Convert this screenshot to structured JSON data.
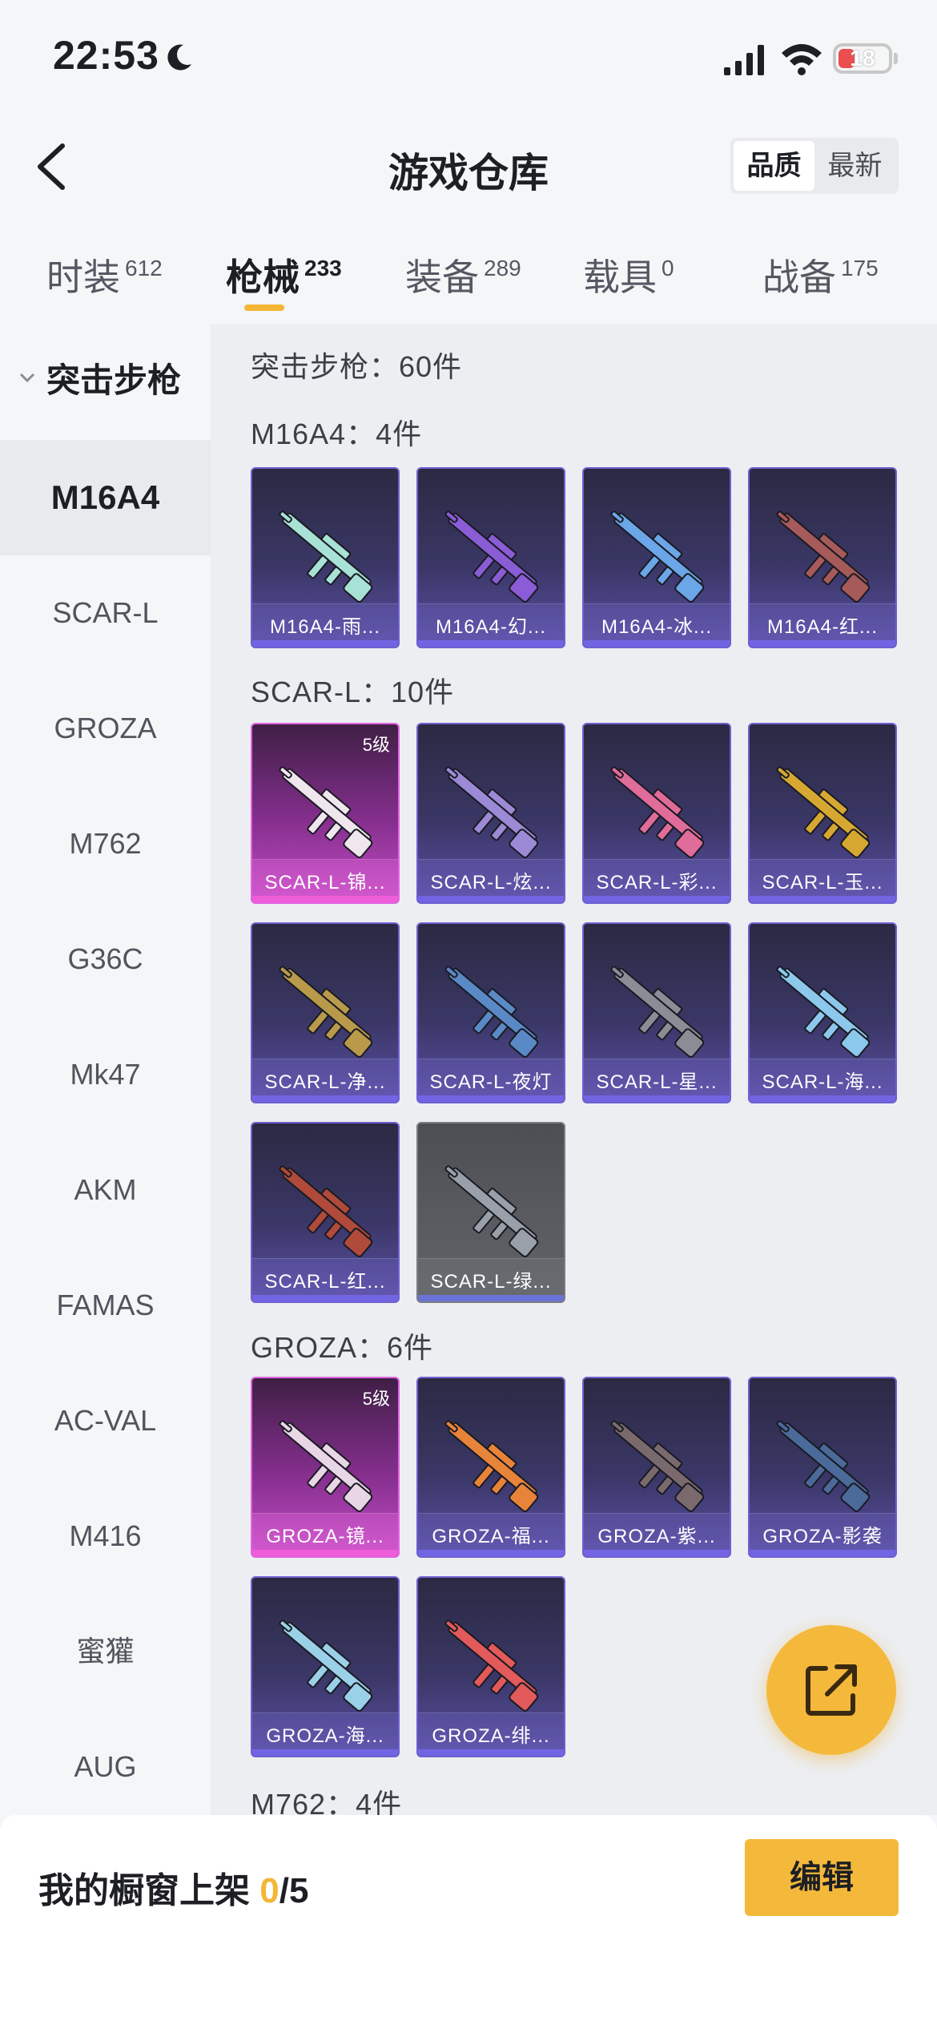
{
  "status_bar": {
    "time": "22:53",
    "battery": "18"
  },
  "header": {
    "title": "游戏仓库",
    "sort_quality": "品质",
    "sort_newest": "最新"
  },
  "tabs": [
    {
      "label": "时装",
      "count": "612"
    },
    {
      "label": "枪械",
      "count": "233"
    },
    {
      "label": "装备",
      "count": "289"
    },
    {
      "label": "载具",
      "count": "0"
    },
    {
      "label": "战备",
      "count": "175"
    }
  ],
  "sidebar": {
    "group": "突击步枪",
    "items": [
      "M16A4",
      "SCAR-L",
      "GROZA",
      "M762",
      "G36C",
      "Mk47",
      "AKM",
      "FAMAS",
      "AC-VAL",
      "M416",
      "蜜獾",
      "AUG"
    ]
  },
  "content": {
    "category_header": "突击步枪：60件",
    "sections": [
      {
        "title": "M16A4：4件",
        "items": [
          {
            "label": "M16A4-雨...",
            "rarity": "purple",
            "color": "#a8e2d6"
          },
          {
            "label": "M16A4-幻...",
            "rarity": "purple",
            "color": "#8a5cd6"
          },
          {
            "label": "M16A4-冰...",
            "rarity": "purple",
            "color": "#6aa6e8"
          },
          {
            "label": "M16A4-红...",
            "rarity": "purple",
            "color": "#a65a5a"
          }
        ]
      },
      {
        "title": "SCAR-L：10件",
        "items": [
          {
            "label": "SCAR-L-锦...",
            "rarity": "pink",
            "level": "5级",
            "color": "#f0e6ee"
          },
          {
            "label": "SCAR-L-炫...",
            "rarity": "purple",
            "color": "#9c8ad6"
          },
          {
            "label": "SCAR-L-彩...",
            "rarity": "purple",
            "color": "#e06c9a"
          },
          {
            "label": "SCAR-L-玉...",
            "rarity": "purple",
            "color": "#d6a832"
          },
          {
            "label": "SCAR-L-净...",
            "rarity": "purple",
            "color": "#b89a4a"
          },
          {
            "label": "SCAR-L-夜灯",
            "rarity": "purple",
            "color": "#5a8ac6"
          },
          {
            "label": "SCAR-L-星...",
            "rarity": "purple",
            "color": "#8a8c96"
          },
          {
            "label": "SCAR-L-海...",
            "rarity": "purple",
            "color": "#8cc8ec"
          },
          {
            "label": "SCAR-L-红...",
            "rarity": "purple",
            "color": "#b04a3a"
          },
          {
            "label": "SCAR-L-绿...",
            "rarity": "gray",
            "color": "#9aa0aa"
          }
        ]
      },
      {
        "title": "GROZA：6件",
        "items": [
          {
            "label": "GROZA-镜...",
            "rarity": "pink",
            "level": "5级",
            "color": "#e8d6e6"
          },
          {
            "label": "GROZA-福...",
            "rarity": "purple",
            "color": "#e8843a"
          },
          {
            "label": "GROZA-紫...",
            "rarity": "purple",
            "color": "#7a6a6e"
          },
          {
            "label": "GROZA-影袭",
            "rarity": "purple",
            "color": "#4a6a9a"
          },
          {
            "label": "GROZA-海...",
            "rarity": "purple",
            "color": "#9ad0e8"
          },
          {
            "label": "GROZA-绯...",
            "rarity": "purple",
            "color": "#e25a5a"
          }
        ]
      },
      {
        "title": "M762：4件",
        "items": []
      }
    ]
  },
  "bottom": {
    "showcase_label": "我的橱窗上架 ",
    "showcase_current": "0",
    "showcase_total": "/5",
    "edit_label": "编辑"
  },
  "colors": {
    "accent": "#f2b736",
    "purple_card": "#3a3766",
    "pink_card": "#862f8f"
  },
  "icons": {
    "fab": "share-export-icon",
    "back": "back-arrow-icon"
  }
}
